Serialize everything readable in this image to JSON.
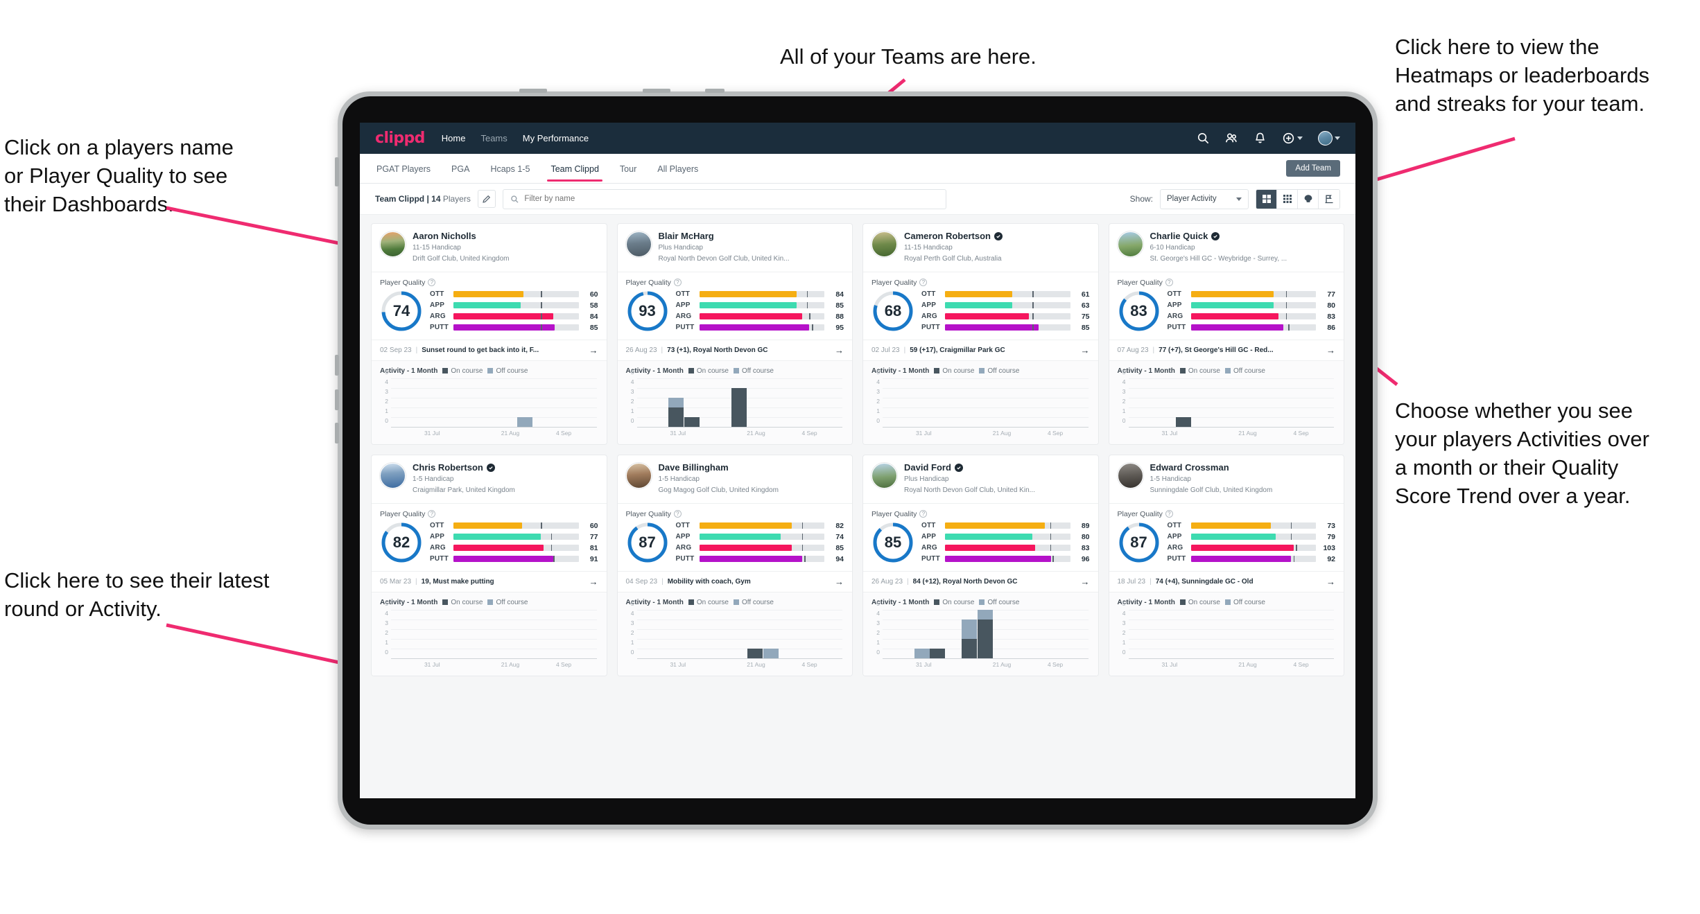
{
  "annotations": [
    {
      "id": "teams",
      "text": "All of your Teams are here."
    },
    {
      "id": "heatmaps",
      "text": "Click here to view the\nHeatmaps or leaderboards\nand streaks for your team."
    },
    {
      "id": "playername",
      "text": "Click on a players name\nor Player Quality to see\ntheir Dashboards."
    },
    {
      "id": "activity_choice",
      "text": "Choose whether you see\nyour players Activities over\na month or their Quality\nScore Trend over a year."
    },
    {
      "id": "latest_round",
      "text": "Click here to see their latest\nround or Activity."
    }
  ],
  "app": {
    "logo": "clippd",
    "nav": [
      {
        "label": "Home",
        "active": true
      },
      {
        "label": "Teams",
        "active": false
      },
      {
        "label": "My Performance",
        "active": false
      }
    ],
    "nav_icons": [
      "search-icon",
      "people-icon",
      "bell-icon",
      "plus-circle-icon",
      "avatar"
    ],
    "tabs": [
      {
        "label": "PGAT Players",
        "active": false
      },
      {
        "label": "PGA",
        "active": false
      },
      {
        "label": "Hcaps 1-5",
        "active": false
      },
      {
        "label": "Team Clippd",
        "active": true
      },
      {
        "label": "Tour",
        "active": false
      },
      {
        "label": "All Players",
        "active": false
      }
    ],
    "add_team_label": "Add Team",
    "team_label_bold": "Team Clippd | 14",
    "team_label_thin": " Players",
    "search_placeholder": "Filter by name",
    "search_value": "",
    "show_label": "Show:",
    "show_value": "Player Activity",
    "view_toggles": [
      "grid-view-icon",
      "table-view-icon",
      "heatmap-icon",
      "leaderboard-icon"
    ],
    "active_view": 0,
    "accent_color": "#ef2b70",
    "navbar_color": "#1b2d3c"
  },
  "card_labels": {
    "player_quality": "Player Quality",
    "activity": "Activity - 1 Month",
    "legend_on": "On course",
    "legend_off": "Off course",
    "arrow": "→"
  },
  "metric_colors": {
    "OTT": "#f5ae12",
    "APP": "#3ddbb0",
    "ARG": "#f5165e",
    "PUTT": "#b512c9"
  },
  "chart_data": {
    "type": "bar",
    "title": "Activity - 1 Month",
    "ylabel": "",
    "xlabel": "",
    "ylim": [
      0,
      5
    ],
    "yticks": [
      0,
      1,
      2,
      3,
      4,
      5
    ],
    "xticks": [
      "31 Jul",
      "21 Aug",
      "4 Sep"
    ],
    "legend": [
      "On course",
      "Off course"
    ],
    "legend_position": "top",
    "grid": true,
    "series_colors": {
      "On course": "#48565f",
      "Off course": "#92a8bb"
    }
  },
  "players": [
    {
      "name": "Aaron Nicholls",
      "verified": false,
      "handicap": "11-15 Handicap",
      "club": "Drift Golf Club, United Kingdom",
      "quality": 74,
      "ring_pct": 74,
      "metrics": [
        {
          "label": "OTT",
          "value": 60,
          "fill": 56,
          "tick": 70
        },
        {
          "label": "APP",
          "value": 58,
          "fill": 54,
          "tick": 70
        },
        {
          "label": "ARG",
          "value": 84,
          "fill": 80,
          "tick": 70
        },
        {
          "label": "PUTT",
          "value": 85,
          "fill": 81,
          "tick": 70
        }
      ],
      "round_date": "02 Sep 23",
      "round_text": "Sunset round to get back into it, F...",
      "activity": [
        {
          "x": 8,
          "on": 0,
          "off": 1
        }
      ]
    },
    {
      "name": "Blair McHarg",
      "verified": false,
      "handicap": "Plus Handicap",
      "club": "Royal North Devon Golf Club, United Kin...",
      "quality": 93,
      "ring_pct": 96,
      "metrics": [
        {
          "label": "OTT",
          "value": 84,
          "fill": 78,
          "tick": 86
        },
        {
          "label": "APP",
          "value": 85,
          "fill": 78,
          "tick": 86
        },
        {
          "label": "ARG",
          "value": 88,
          "fill": 82,
          "tick": 88
        },
        {
          "label": "PUTT",
          "value": 95,
          "fill": 88,
          "tick": 90
        }
      ],
      "round_date": "26 Aug 23",
      "round_text": "73 (+1), Royal North Devon GC",
      "activity": [
        {
          "x": 2,
          "on": 2,
          "off": 1
        },
        {
          "x": 3,
          "on": 1,
          "off": 0
        },
        {
          "x": 6,
          "on": 4,
          "off": 0
        }
      ]
    },
    {
      "name": "Cameron Robertson",
      "verified": true,
      "handicap": "11-15 Handicap",
      "club": "Royal Perth Golf Club, Australia",
      "quality": 68,
      "ring_pct": 80,
      "metrics": [
        {
          "label": "OTT",
          "value": 61,
          "fill": 54,
          "tick": 70
        },
        {
          "label": "APP",
          "value": 63,
          "fill": 54,
          "tick": 70
        },
        {
          "label": "ARG",
          "value": 75,
          "fill": 67,
          "tick": 70
        },
        {
          "label": "PUTT",
          "value": 85,
          "fill": 75,
          "tick": 70
        }
      ],
      "round_date": "02 Jul 23",
      "round_text": "59 (+17), Craigmillar Park GC",
      "activity": []
    },
    {
      "name": "Charlie Quick",
      "verified": true,
      "handicap": "6-10 Handicap",
      "club": "St. George's Hill GC - Weybridge - Surrey, ...",
      "quality": 83,
      "ring_pct": 86,
      "metrics": [
        {
          "label": "OTT",
          "value": 77,
          "fill": 66,
          "tick": 76
        },
        {
          "label": "APP",
          "value": 80,
          "fill": 66,
          "tick": 76
        },
        {
          "label": "ARG",
          "value": 83,
          "fill": 70,
          "tick": 76
        },
        {
          "label": "PUTT",
          "value": 86,
          "fill": 74,
          "tick": 78
        }
      ],
      "round_date": "07 Aug 23",
      "round_text": "77 (+7), St George's Hill GC - Red...",
      "activity": [
        {
          "x": 3,
          "on": 1,
          "off": 0
        }
      ]
    },
    {
      "name": "Chris Robertson",
      "verified": true,
      "handicap": "1-5 Handicap",
      "club": "Craigmillar Park, United Kingdom",
      "quality": 82,
      "ring_pct": 85,
      "metrics": [
        {
          "label": "OTT",
          "value": 60,
          "fill": 55,
          "tick": 70
        },
        {
          "label": "APP",
          "value": 77,
          "fill": 70,
          "tick": 78
        },
        {
          "label": "ARG",
          "value": 81,
          "fill": 72,
          "tick": 78
        },
        {
          "label": "PUTT",
          "value": 91,
          "fill": 80,
          "tick": 80
        }
      ],
      "round_date": "05 Mar 23",
      "round_text": "19, Must make putting",
      "activity": []
    },
    {
      "name": "Dave Billingham",
      "verified": false,
      "handicap": "1-5 Handicap",
      "club": "Gog Magog Golf Club, United Kingdom",
      "quality": 87,
      "ring_pct": 90,
      "metrics": [
        {
          "label": "OTT",
          "value": 82,
          "fill": 74,
          "tick": 82
        },
        {
          "label": "APP",
          "value": 74,
          "fill": 65,
          "tick": 82
        },
        {
          "label": "ARG",
          "value": 85,
          "fill": 74,
          "tick": 82
        },
        {
          "label": "PUTT",
          "value": 94,
          "fill": 82,
          "tick": 84
        }
      ],
      "round_date": "04 Sep 23",
      "round_text": "Mobility with coach, Gym",
      "activity": [
        {
          "x": 7,
          "on": 1,
          "off": 0
        },
        {
          "x": 8,
          "on": 0,
          "off": 1
        }
      ]
    },
    {
      "name": "David Ford",
      "verified": true,
      "handicap": "Plus Handicap",
      "club": "Royal North Devon Golf Club, United Kin...",
      "quality": 85,
      "ring_pct": 88,
      "metrics": [
        {
          "label": "OTT",
          "value": 89,
          "fill": 80,
          "tick": 84
        },
        {
          "label": "APP",
          "value": 80,
          "fill": 70,
          "tick": 84
        },
        {
          "label": "ARG",
          "value": 83,
          "fill": 72,
          "tick": 84
        },
        {
          "label": "PUTT",
          "value": 96,
          "fill": 85,
          "tick": 86
        }
      ],
      "round_date": "26 Aug 23",
      "round_text": "84 (+12), Royal North Devon GC",
      "activity": [
        {
          "x": 2,
          "on": 0,
          "off": 1
        },
        {
          "x": 3,
          "on": 1,
          "off": 0
        },
        {
          "x": 5,
          "on": 2,
          "off": 2
        },
        {
          "x": 6,
          "on": 4,
          "off": 1
        }
      ]
    },
    {
      "name": "Edward Crossman",
      "verified": false,
      "handicap": "1-5 Handicap",
      "club": "Sunningdale Golf Club, United Kingdom",
      "quality": 87,
      "ring_pct": 90,
      "metrics": [
        {
          "label": "OTT",
          "value": 73,
          "fill": 64,
          "tick": 80
        },
        {
          "label": "APP",
          "value": 79,
          "fill": 68,
          "tick": 80
        },
        {
          "label": "ARG",
          "value": 103,
          "fill": 82,
          "tick": 84
        },
        {
          "label": "PUTT",
          "value": 92,
          "fill": 80,
          "tick": 82
        }
      ],
      "round_date": "18 Jul 23",
      "round_text": "74 (+4), Sunningdale GC - Old",
      "activity": []
    }
  ]
}
